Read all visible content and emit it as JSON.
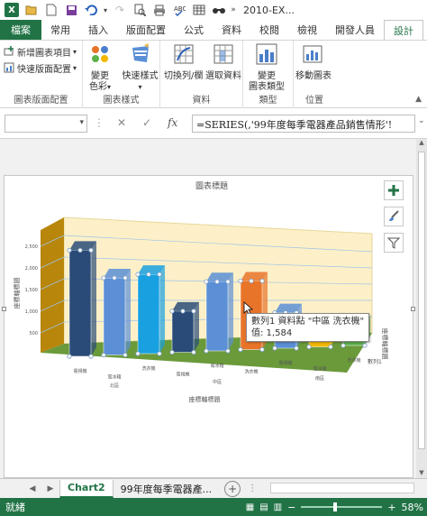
{
  "window": {
    "title": "2010-EX..."
  },
  "tabs": [
    {
      "label": "檔案"
    },
    {
      "label": "常用"
    },
    {
      "label": "插入"
    },
    {
      "label": "版面配置"
    },
    {
      "label": "公式"
    },
    {
      "label": "資料"
    },
    {
      "label": "校閱"
    },
    {
      "label": "檢視"
    },
    {
      "label": "開發人員"
    },
    {
      "label": "設計"
    }
  ],
  "ribbon": {
    "add_element": "新增圖表項目",
    "quick_layout": "快速版面配置",
    "group_layout": "圖表版面配置",
    "change_colors_1": "變更",
    "change_colors_2": "色彩",
    "quick_styles": "快速樣式",
    "group_styles": "圖表樣式",
    "switch_row_col": "切換列/欄",
    "select_data": "選取資料",
    "group_data": "資料",
    "change_type_1": "變更",
    "change_type_2": "圖表類型",
    "group_type": "類型",
    "move_chart": "移動圖表",
    "group_location": "位置"
  },
  "formula_bar": {
    "name_box": "",
    "formula": "=SERIES(,'99年度每季電器產品銷售情形'!"
  },
  "chart_data": {
    "type": "bar",
    "title": "圖表標題",
    "xlabel": "座標軸標題",
    "ylabel": "座標軸標題",
    "zlabel": "座標軸標題",
    "series_label": "數列1",
    "ylim": [
      0,
      2500
    ],
    "yticks": [
      "2,500",
      "2,000",
      "1,500",
      "1,000",
      "500"
    ],
    "categories": [
      "電視機",
      "電冰箱",
      "洗衣機",
      "電視機",
      "電冰箱",
      "洗衣機",
      "電視機",
      "電冰箱",
      "洗衣機"
    ],
    "groups": [
      "北區",
      "中區",
      "南區"
    ],
    "values": [
      2450,
      1780,
      1830,
      950,
      1600,
      1584,
      820,
      520,
      460
    ],
    "colors": [
      "#2a4b78",
      "#5b8fd6",
      "#18a0e0",
      "#2a4b78",
      "#5b8fd6",
      "#e8742a",
      "#5b8fd6",
      "#f5b800",
      "#5db14a"
    ],
    "tooltip_line1": "數列1 資料點 \"中區 洗衣機\"",
    "tooltip_line2": "值: 1,584"
  },
  "sheet_tabs": [
    {
      "label": "Chart2"
    },
    {
      "label": "99年度每季電器產..."
    }
  ],
  "status": {
    "ready": "就緒",
    "zoom": "58%"
  }
}
